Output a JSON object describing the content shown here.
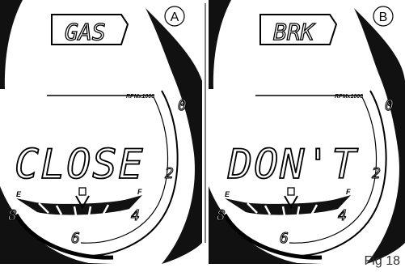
{
  "figure": {
    "caption": "Fig 18",
    "panels": [
      {
        "marker": "A",
        "top_word": "GAS",
        "main_word": "CLOSE",
        "rpm_label": "RPMx1000",
        "fuel_empty": "E",
        "fuel_full": "F",
        "tach_labels": [
          "0",
          "2",
          "4",
          "6",
          "8"
        ]
      },
      {
        "marker": "B",
        "top_word": "BRK",
        "main_word": "DON'T",
        "rpm_label": "RPMx1000",
        "fuel_empty": "E",
        "fuel_full": "F",
        "tach_labels": [
          "0",
          "2",
          "4",
          "6",
          "8"
        ]
      }
    ]
  }
}
